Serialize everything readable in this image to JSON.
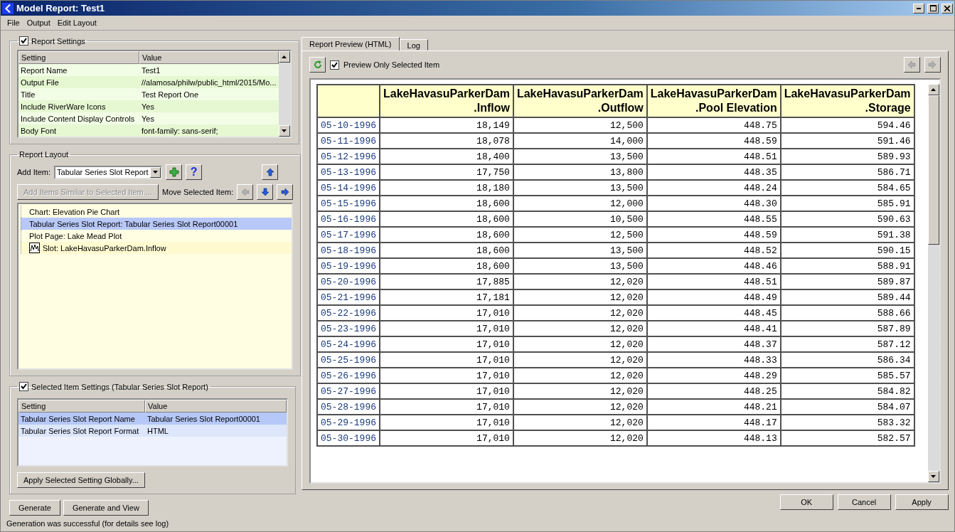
{
  "window": {
    "title": "Model Report: Test1"
  },
  "menu": [
    "File",
    "Output",
    "Edit Layout"
  ],
  "report_settings": {
    "label": "Report Settings",
    "checked": true,
    "columns": [
      "Setting",
      "Value"
    ],
    "rows": [
      {
        "setting": "Report Name",
        "value": "Test1"
      },
      {
        "setting": "Output File",
        "value": "//alamosa/philw/public_html/2015/Mo..."
      },
      {
        "setting": "Title",
        "value": "Test Report One"
      },
      {
        "setting": "Include RiverWare Icons",
        "value": "Yes"
      },
      {
        "setting": "Include Content Display Controls",
        "value": "Yes"
      },
      {
        "setting": "Body Font",
        "value": "font-family: sans-serif;"
      }
    ]
  },
  "report_layout": {
    "label": "Report Layout",
    "add_item_label": "Add Item:",
    "add_item_value": "Tabular Series Slot Report",
    "help_button": "?",
    "similar_button": {
      "label": "Add Items Similar to Selected Item ...",
      "disabled": true
    },
    "move_label": "Move Selected Item:",
    "move_buttons": [
      {
        "kind": "up",
        "disabled": false
      },
      {
        "kind": "left",
        "disabled": true
      },
      {
        "kind": "down",
        "disabled": false
      },
      {
        "kind": "right",
        "disabled": false
      }
    ],
    "items": [
      {
        "label": "Chart: Elevation Pie Chart",
        "kind": "text",
        "selected": false
      },
      {
        "label": "Tabular Series Slot Report: Tabular Series Slot Report00001",
        "kind": "text",
        "selected": true
      },
      {
        "label": "Plot Page: Lake Mead Plot",
        "kind": "text",
        "selected": false
      },
      {
        "label": "Slot: LakeHavasuParkerDam.Inflow",
        "kind": "slot",
        "selected": false
      }
    ]
  },
  "selected_item_settings": {
    "label": "Selected Item Settings (Tabular Series Slot Report)",
    "checked": true,
    "columns": [
      "Setting",
      "Value"
    ],
    "rows": [
      {
        "setting": "Tabular Series Slot Report Name",
        "value": "Tabular Series Slot Report00001",
        "selected": true
      },
      {
        "setting": "Tabular Series Slot Report Format",
        "value": "HTML",
        "selected": false
      }
    ],
    "apply_button": "Apply Selected Setting Globally..."
  },
  "left_buttons": [
    "Generate",
    "Generate and View"
  ],
  "status_bar": "Generation was successful (for details see log)",
  "tabs": [
    {
      "label": "Report Preview (HTML)",
      "selected": true
    },
    {
      "label": "Log",
      "selected": false
    }
  ],
  "preview_only_selected": {
    "label": "Preview Only Selected Item",
    "checked": true
  },
  "nav_buttons": [
    {
      "kind": "left",
      "disabled": true
    },
    {
      "kind": "right",
      "disabled": true
    }
  ],
  "table": {
    "columns": [
      "",
      "LakeHavasuParkerDam\n.Inflow",
      "LakeHavasuParkerDam\n.Outflow",
      "LakeHavasuParkerDam\n.Pool Elevation",
      "LakeHavasuParkerDam\n.Storage"
    ],
    "rows": [
      [
        "05-10-1996",
        "18,149",
        "12,500",
        "448.75",
        "594.46"
      ],
      [
        "05-11-1996",
        "18,078",
        "14,000",
        "448.59",
        "591.46"
      ],
      [
        "05-12-1996",
        "18,400",
        "13,500",
        "448.51",
        "589.93"
      ],
      [
        "05-13-1996",
        "17,750",
        "13,800",
        "448.35",
        "586.71"
      ],
      [
        "05-14-1996",
        "18,180",
        "13,500",
        "448.24",
        "584.65"
      ],
      [
        "05-15-1996",
        "18,600",
        "12,000",
        "448.30",
        "585.91"
      ],
      [
        "05-16-1996",
        "18,600",
        "10,500",
        "448.55",
        "590.63"
      ],
      [
        "05-17-1996",
        "18,600",
        "12,500",
        "448.59",
        "591.38"
      ],
      [
        "05-18-1996",
        "18,600",
        "13,500",
        "448.52",
        "590.15"
      ],
      [
        "05-19-1996",
        "18,600",
        "13,500",
        "448.46",
        "588.91"
      ],
      [
        "05-20-1996",
        "17,885",
        "12,020",
        "448.51",
        "589.87"
      ],
      [
        "05-21-1996",
        "17,181",
        "12,020",
        "448.49",
        "589.44"
      ],
      [
        "05-22-1996",
        "17,010",
        "12,020",
        "448.45",
        "588.66"
      ],
      [
        "05-23-1996",
        "17,010",
        "12,020",
        "448.41",
        "587.89"
      ],
      [
        "05-24-1996",
        "17,010",
        "12,020",
        "448.37",
        "587.12"
      ],
      [
        "05-25-1996",
        "17,010",
        "12,020",
        "448.33",
        "586.34"
      ],
      [
        "05-26-1996",
        "17,010",
        "12,020",
        "448.29",
        "585.57"
      ],
      [
        "05-27-1996",
        "17,010",
        "12,020",
        "448.25",
        "584.82"
      ],
      [
        "05-28-1996",
        "17,010",
        "12,020",
        "448.21",
        "584.07"
      ],
      [
        "05-29-1996",
        "17,010",
        "12,020",
        "448.17",
        "583.32"
      ],
      [
        "05-30-1996",
        "17,010",
        "12,020",
        "448.13",
        "582.57"
      ]
    ]
  },
  "dialog_buttons": [
    "OK",
    "Cancel",
    "Apply"
  ]
}
